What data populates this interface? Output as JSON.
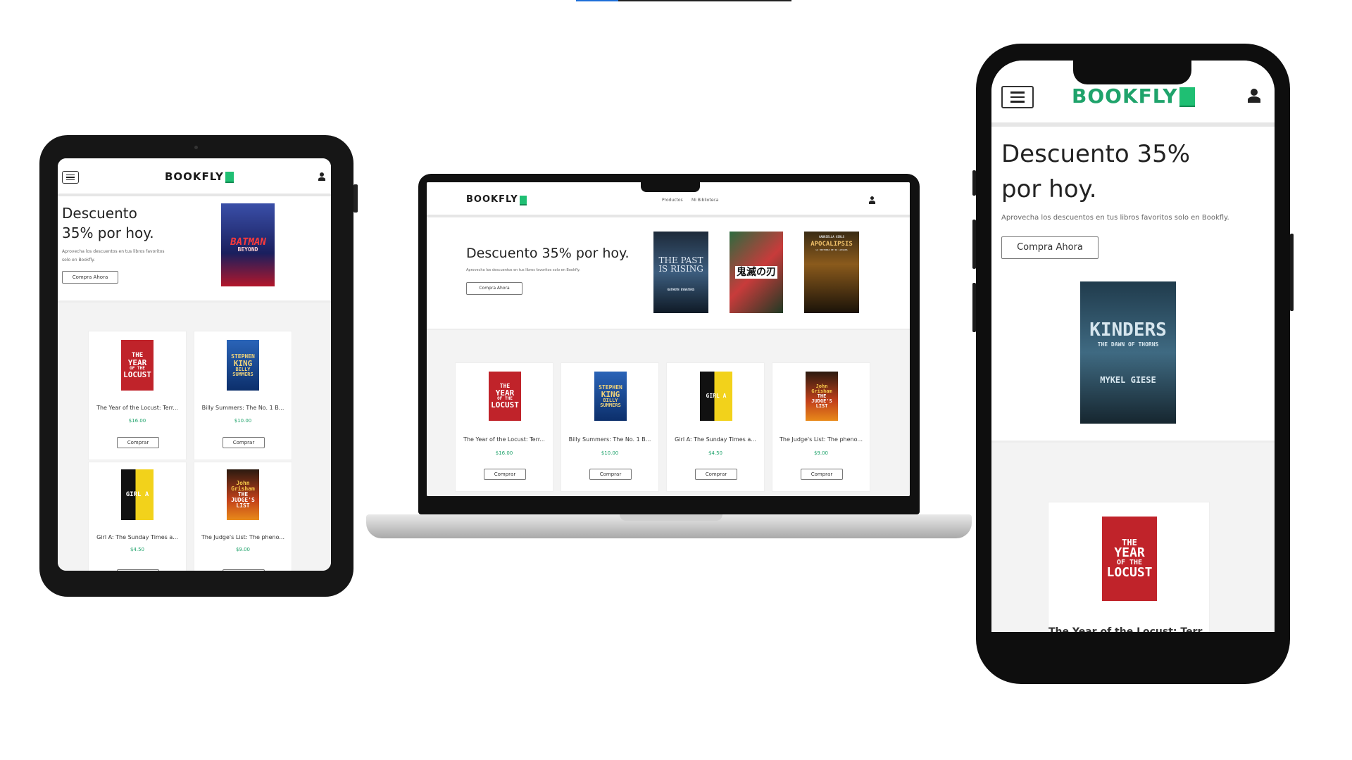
{
  "brand": {
    "name": "BOOKFLY",
    "accent": "#1fbf73"
  },
  "nav": {
    "productos": "Productos",
    "biblioteca": "Mi Biblioteca"
  },
  "hero": {
    "title": "Descuento 35% por hoy.",
    "subtitle": "Aprovecha los descuentos en tus libros favoritos solo en Bookfly.",
    "cta": "Compra Ahora"
  },
  "featured": {
    "batman": {
      "title": "BATMAN",
      "sub": "BEYOND"
    },
    "past": {
      "title": "THE PAST IS RISING",
      "author": "KATHRYN BYWATERS"
    },
    "anime": {
      "title": "鬼滅の刃"
    },
    "apocalipsis": {
      "kicker": "GABRIELLA GIRLS",
      "title": "APOCALIPSIS",
      "sub": "LA HISTORIA DE SU LLEGADA"
    },
    "kinders": {
      "title": "KINDERS",
      "sub": "THE DAWN OF THORNS",
      "author": "MYKEL GIESE"
    }
  },
  "products": [
    {
      "title": "The Year of the Locust: Terr...",
      "price": "$16.00",
      "cover": [
        "THE",
        "YEAR",
        "OF THE",
        "LOCUST"
      ]
    },
    {
      "title": "Billy Summers: The No. 1 B...",
      "price": "$10.00",
      "cover": [
        "STEPHEN",
        "KING",
        "BILLY",
        "SUMMERS"
      ]
    },
    {
      "title": "Girl A: The Sunday Times a...",
      "price": "$4.50",
      "cover": [
        "GIRL A"
      ]
    },
    {
      "title": "The Judge's List: The pheno...",
      "price": "$9.00",
      "cover": [
        "John",
        "Grisham",
        "THE",
        "JUDGE'S",
        "LIST"
      ]
    }
  ],
  "buy_label": "Comprar",
  "colors": {
    "price": "#1fa36b",
    "gray_bg": "#f3f3f3",
    "device": "#161616"
  },
  "icons": [
    "menu-icon",
    "user-icon",
    "book-icon",
    "camera-icon"
  ]
}
